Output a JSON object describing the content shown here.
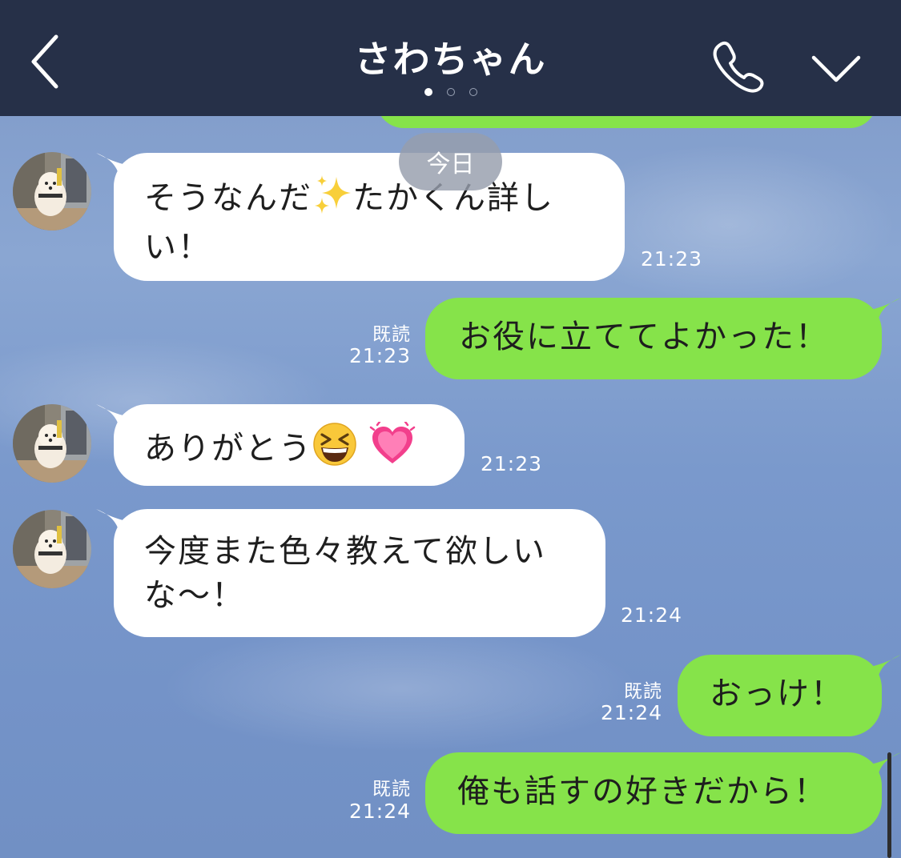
{
  "header": {
    "title": "さわちゃん",
    "back_icon": "chevron-left-icon",
    "call_icon": "phone-icon",
    "menu_icon": "chevron-down-icon",
    "page_dots": {
      "count": 3,
      "active": 1
    }
  },
  "date_divider": "今日",
  "colors": {
    "header_bg": "#263048",
    "outgoing_bubble": "#86e34a",
    "incoming_bubble": "#ffffff",
    "chat_bg": "#7d98c7"
  },
  "messages": [
    {
      "direction": "incoming",
      "line1": "そうなんだ",
      "emoji": "sparkles-emoji",
      "line1b": "たかくん詳し",
      "line2": "い！",
      "time": "21:23"
    },
    {
      "direction": "outgoing",
      "text": "お役に立ててよかった！",
      "read": "既読",
      "time": "21:23"
    },
    {
      "direction": "incoming",
      "text": "ありがとう",
      "emoji": [
        "grinning-squinting-face-emoji",
        "growing-heart-emoji"
      ],
      "time": "21:23"
    },
    {
      "direction": "incoming",
      "line1": "今度また色々教えて欲しい",
      "line2": "な〜！",
      "time": "21:24"
    },
    {
      "direction": "outgoing",
      "text": "おっけ！",
      "read": "既読",
      "time": "21:24"
    },
    {
      "direction": "outgoing",
      "text": "俺も話すの好きだから！",
      "read": "既読",
      "time": "21:24"
    }
  ]
}
